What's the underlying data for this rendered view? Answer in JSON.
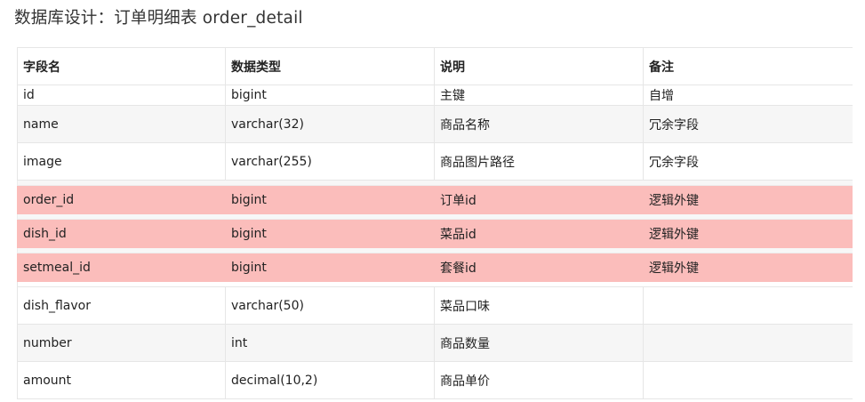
{
  "title": "数据库设计：订单明细表 order_detail",
  "headers": [
    "字段名",
    "数据类型",
    "说明",
    "备注"
  ],
  "rows": [
    {
      "field": "id",
      "type": "bigint",
      "desc": "主键",
      "note": "自增",
      "highlight": false
    },
    {
      "field": "name",
      "type": "varchar(32)",
      "desc": "商品名称",
      "note": "冗余字段",
      "highlight": false
    },
    {
      "field": "image",
      "type": "varchar(255)",
      "desc": "商品图片路径",
      "note": "冗余字段",
      "highlight": false
    },
    {
      "field": "order_id",
      "type": "bigint",
      "desc": "订单id",
      "note": "逻辑外键",
      "highlight": true
    },
    {
      "field": "dish_id",
      "type": "bigint",
      "desc": "菜品id",
      "note": "逻辑外键",
      "highlight": true
    },
    {
      "field": "setmeal_id",
      "type": "bigint",
      "desc": "套餐id",
      "note": "逻辑外键",
      "highlight": true
    },
    {
      "field": "dish_flavor",
      "type": "varchar(50)",
      "desc": "菜品口味",
      "note": "",
      "highlight": false
    },
    {
      "field": "number",
      "type": "int",
      "desc": "商品数量",
      "note": "",
      "highlight": false
    },
    {
      "field": "amount",
      "type": "decimal(10,2)",
      "desc": "商品单价",
      "note": "",
      "highlight": false
    }
  ],
  "colors": {
    "highlight_row": "#fbbdbb",
    "alt_row": "#f6f6f6"
  }
}
